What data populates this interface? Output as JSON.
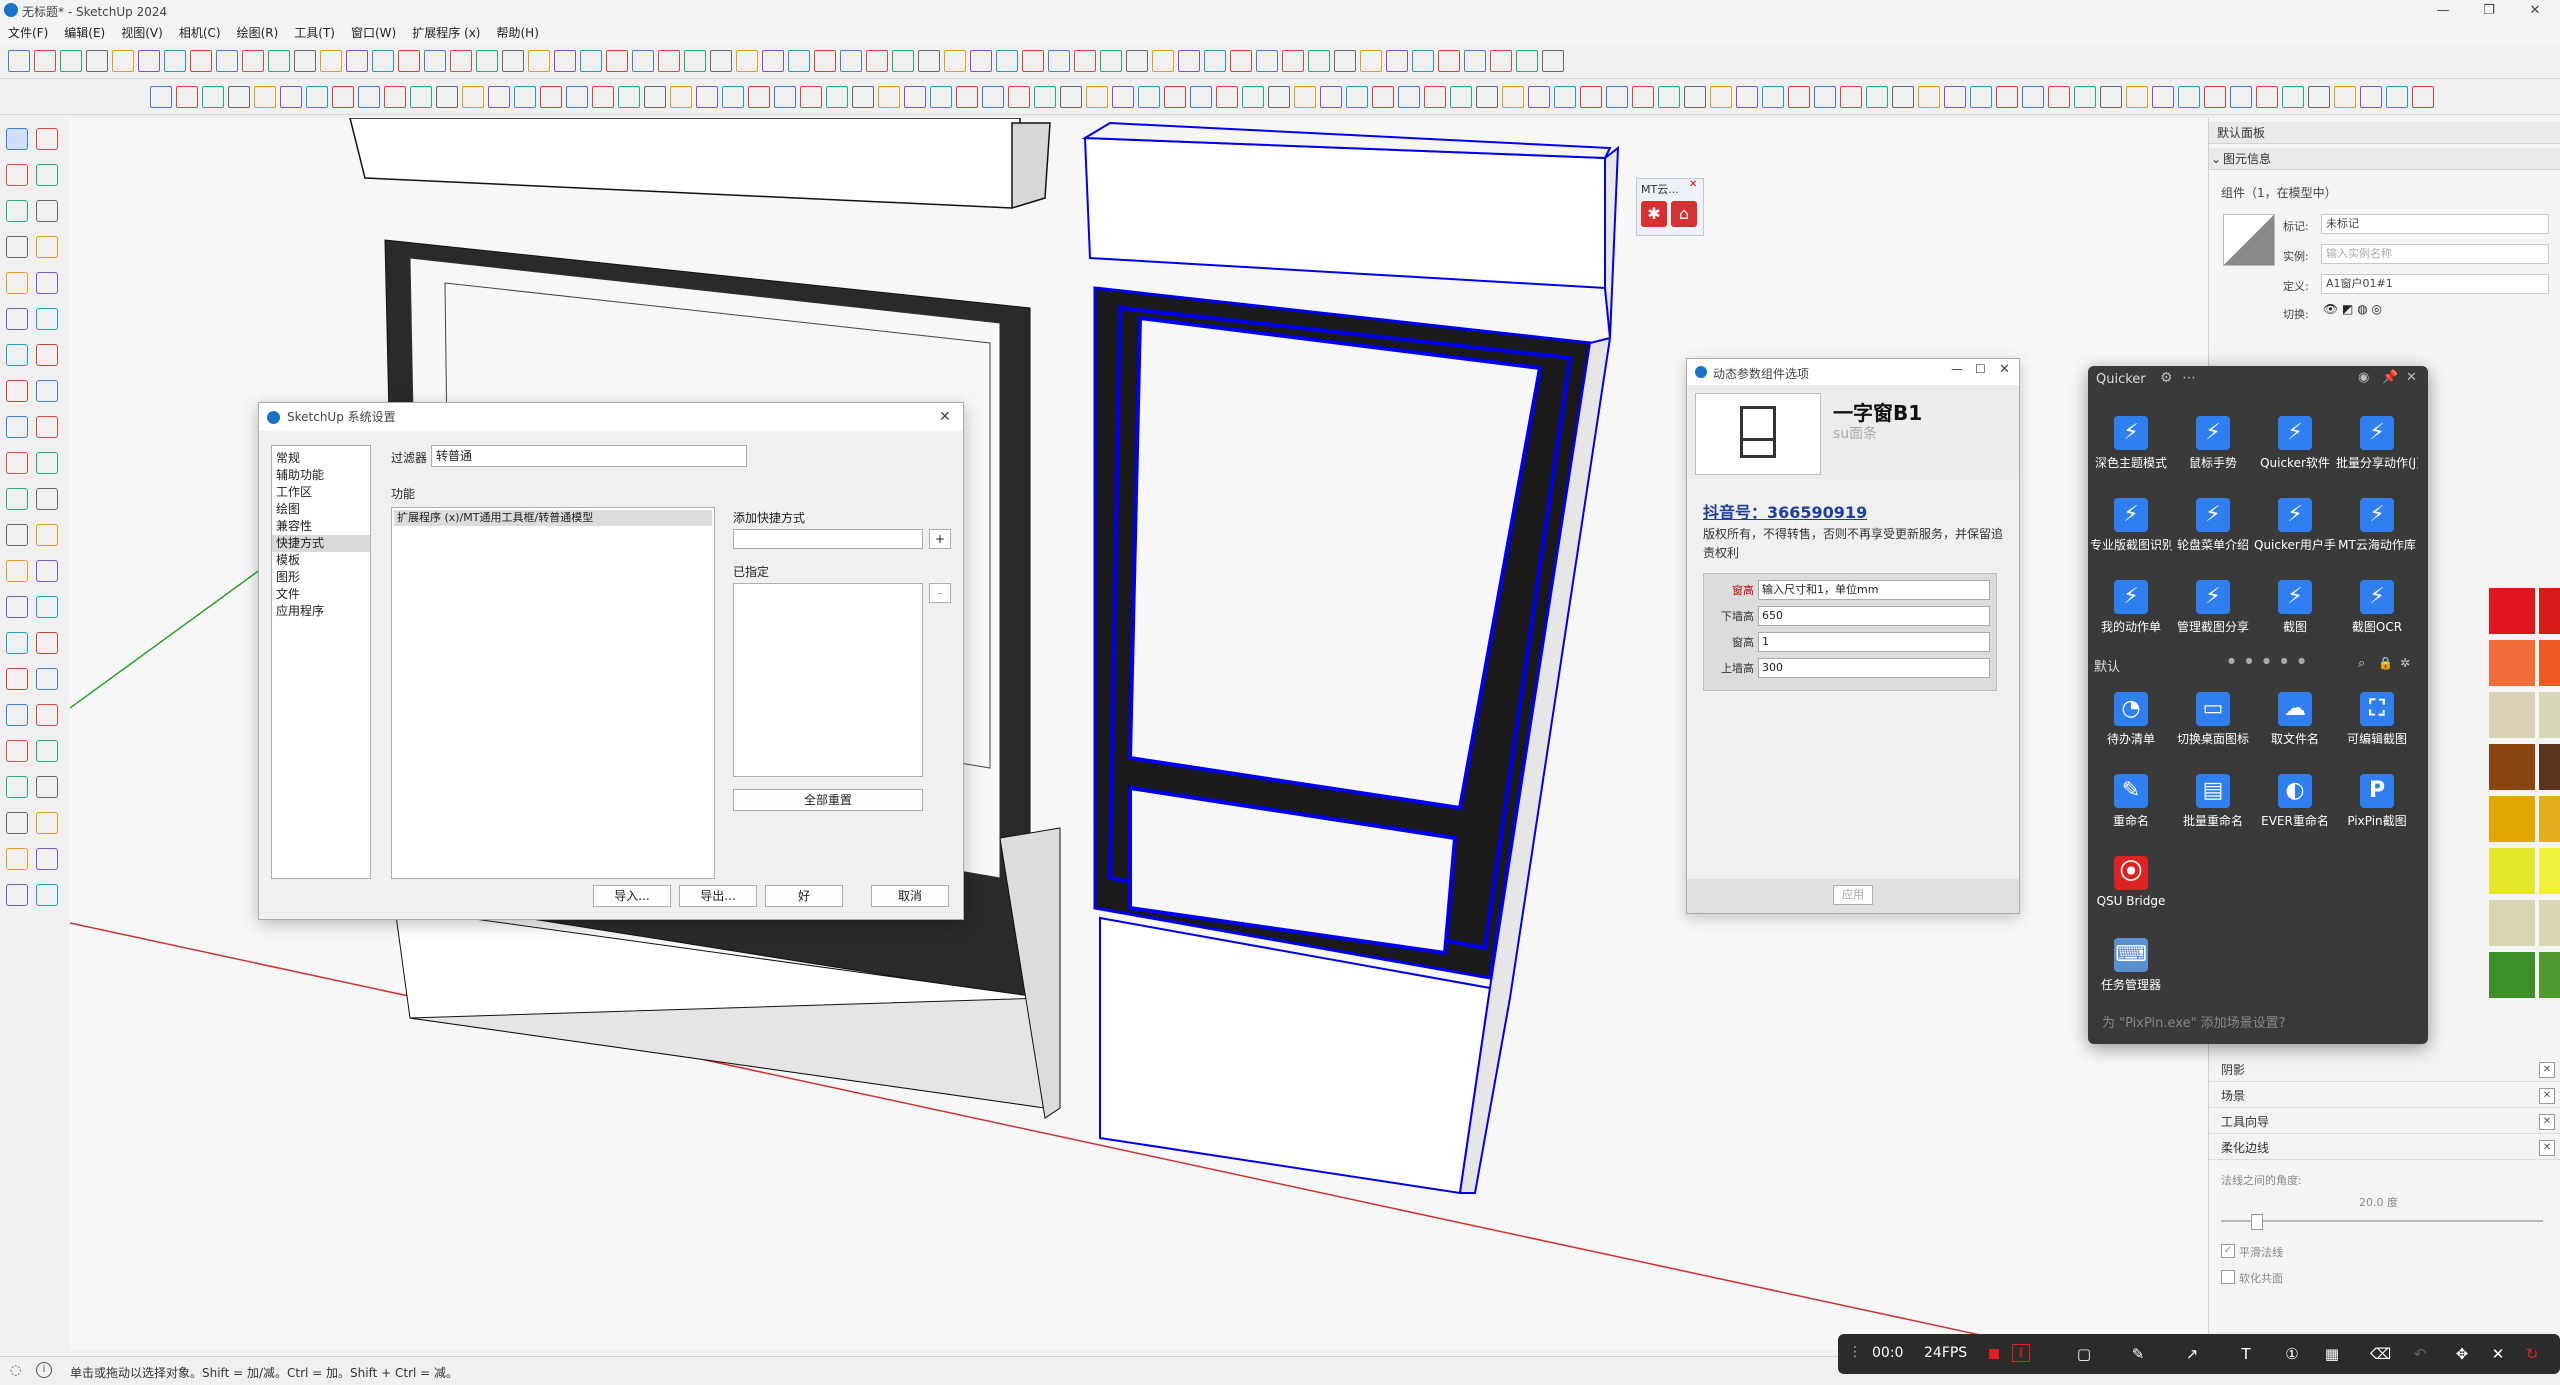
{
  "app": {
    "title": "无标题* - SketchUp 2024"
  },
  "menu": [
    "文件(F)",
    "编辑(E)",
    "视图(V)",
    "相机(C)",
    "绘图(R)",
    "工具(T)",
    "窗口(W)",
    "扩展程序 (x)",
    "帮助(H)"
  ],
  "status": {
    "hint": "单击或拖动以选择对象。Shift = 加/减。Ctrl = 加。Shift + Ctrl = 减。"
  },
  "mt_popup": {
    "label": "MT云..."
  },
  "prefs_dialog": {
    "title": "SketchUp 系统设置",
    "categories": [
      "常规",
      "辅助功能",
      "工作区",
      "绘图",
      "兼容性",
      "快捷方式",
      "模板",
      "图形",
      "文件",
      "应用程序"
    ],
    "selected_category": "快捷方式",
    "filter_label": "过滤器",
    "filter_value": "转普通",
    "function_label": "功能",
    "function_item": "扩展程序 (x)/MT通用工具框/转普通模型",
    "add_shortcut_label": "添加快捷方式",
    "add_btn": "+",
    "assigned_label": "已指定",
    "remove_btn": "-",
    "reset_all": "全部重置",
    "import_btn": "导入...",
    "export_btn": "导出...",
    "ok_btn": "好",
    "cancel_btn": "取消"
  },
  "param_dialog": {
    "title": "动态参数组件选项",
    "component_name": "一字窗B1",
    "component_sub": "su面条",
    "douyin": "抖音号：366590919",
    "copyright": "版权所有，不得转售，否则不再享受更新服务，并保留追责权利",
    "rows": [
      {
        "label": "窗高",
        "value": "输入尺寸和1，单位mm"
      },
      {
        "label": "下墙高",
        "value": "650"
      },
      {
        "label": "窗高",
        "value": "1"
      },
      {
        "label": "上墙高",
        "value": "300"
      }
    ],
    "apply_btn": "应用"
  },
  "quicker": {
    "title": "Quicker",
    "items_top": [
      "深色主题模式",
      "鼠标手势",
      "Quicker软件",
      "批量分享动作(J)",
      "专业版截图识别",
      "轮盘菜单介绍",
      "Quicker用户手册",
      "MT云海动作库",
      "我的动作单",
      "管理截图分享",
      "截图",
      "截图OCR"
    ],
    "section": "默认",
    "items_bottom": [
      "待办清单",
      "切换桌面图标",
      "取文件名",
      "可编辑截图",
      "重命名",
      "批量重命名",
      "EVER重命名",
      "PixPin截图",
      "QSU Bridge",
      "",
      "",
      "",
      "任务管理器"
    ],
    "footer": "为 \"PixPin.exe\" 添加场景设置?"
  },
  "right_panel": {
    "title": "默认面板",
    "entity_info": "图元信息",
    "entity_summary": "组件（1，在模型中）",
    "tag_label": "标记:",
    "tag_value": "未标记",
    "instance_label": "实例:",
    "instance_placeholder": "输入实例名称",
    "definition_label": "定义:",
    "definition_value": "A1窗户01#1",
    "toggle_label": "切换:",
    "sections": [
      "阴影",
      "场景",
      "工具向导",
      "柔化边线"
    ],
    "soften_angle_label": "法线之间的角度:",
    "soften_angle_value": "20.0 度",
    "smooth_normals": "平滑法线",
    "soften_coplanar": "软化共面"
  },
  "swatch_colors": [
    "#e0141e",
    "#d81a1a",
    "#f06b3a",
    "#ee5a24",
    "#d9d2b4",
    "#d8d7b8",
    "#8b4513",
    "#5a3320",
    "#e0a800",
    "#e3ac1c",
    "#e6e62a",
    "#f0ef3a",
    "#d7d6b0",
    "#d9d8b2",
    "#3e8e2a",
    "#4f9a2f"
  ],
  "recorder": {
    "time": "00:0",
    "fps": "24FPS"
  }
}
